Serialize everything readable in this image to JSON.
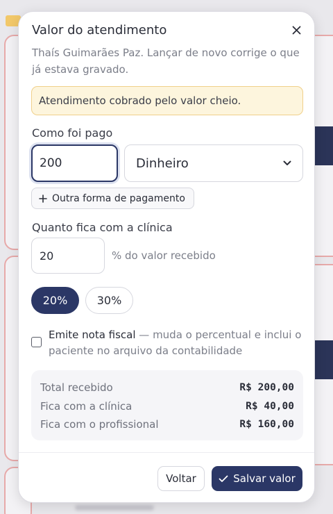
{
  "modal": {
    "title": "Valor do atendimento",
    "subtitle": "Thaís Guimarães Paz. Lançar de novo corrige o que já estava gravado.",
    "notice": "Atendimento cobrado pelo valor cheio."
  },
  "payment": {
    "label": "Como foi pago",
    "amount": "200",
    "method": "Dinheiro",
    "add_label": "Outra forma de pagamento"
  },
  "clinic_share": {
    "label": "Quanto fica com a clínica",
    "percent": "20",
    "suffix": "% do valor recebido",
    "presets": [
      "20%",
      "30%"
    ]
  },
  "invoice": {
    "label": "Emite nota fiscal",
    "hint": " — muda o percentual e inclui o paciente no arquivo da contabilidade",
    "checked": false
  },
  "summary": {
    "rows": [
      {
        "label": "Total recebido",
        "value": "R$ 200,00"
      },
      {
        "label": "Fica com a clínica",
        "value": "R$ 40,00"
      },
      {
        "label": "Fica com o profissional",
        "value": "R$ 160,00"
      }
    ]
  },
  "footer": {
    "back": "Voltar",
    "save": "Salvar valor"
  },
  "colors": {
    "primary": "#2b3766",
    "notice_bg": "#fdf5dd",
    "notice_border": "#f0d08a"
  }
}
